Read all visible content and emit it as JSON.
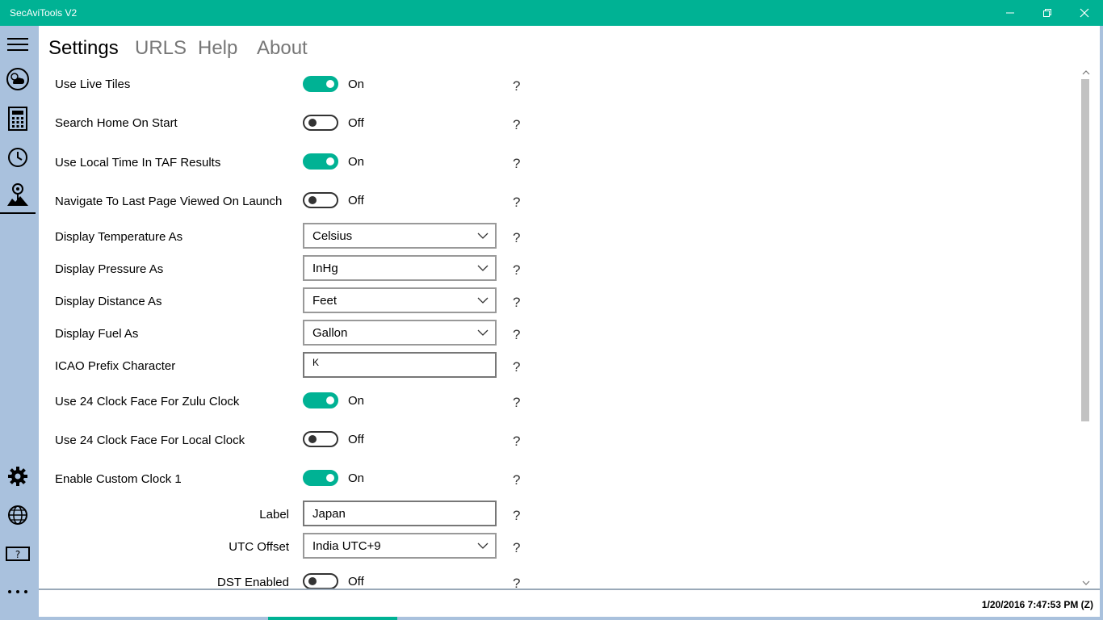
{
  "app": {
    "title": "SecAviTools V2"
  },
  "tabs": [
    "Settings",
    "URLS",
    "Help",
    "About"
  ],
  "help_glyph": "?",
  "settings": {
    "use_live_tiles": {
      "label": "Use Live Tiles",
      "state": "On"
    },
    "search_home": {
      "label": "Search Home On Start",
      "state": "Off"
    },
    "local_time_taf": {
      "label": "Use Local Time In TAF Results",
      "state": "On"
    },
    "navigate_last": {
      "label": "Navigate To Last Page Viewed On Launch",
      "state": "Off"
    },
    "temperature": {
      "label": "Display Temperature As",
      "value": "Celsius"
    },
    "pressure": {
      "label": "Display Pressure As",
      "value": "InHg"
    },
    "distance": {
      "label": "Display Distance As",
      "value": "Feet"
    },
    "fuel": {
      "label": "Display Fuel As",
      "value": "Gallon"
    },
    "icao": {
      "label": "ICAO Prefix Character",
      "value": "K"
    },
    "zulu_24": {
      "label": "Use 24 Clock Face For Zulu Clock",
      "state": "On"
    },
    "local_24": {
      "label": "Use 24 Clock Face For Local Clock",
      "state": "Off"
    },
    "custom_clock1": {
      "label": "Enable Custom Clock 1",
      "state": "On"
    },
    "clock_label": {
      "label": "Label",
      "value": "Japan"
    },
    "utc_offset": {
      "label": "UTC Offset",
      "value": "India UTC+9"
    },
    "dst": {
      "label": "DST Enabled",
      "state": "Off"
    }
  },
  "status": {
    "clock": "1/20/2016 7:47:53 PM (Z)"
  },
  "colors": {
    "accent": "#00b294",
    "nav": "#a9c1dd"
  }
}
